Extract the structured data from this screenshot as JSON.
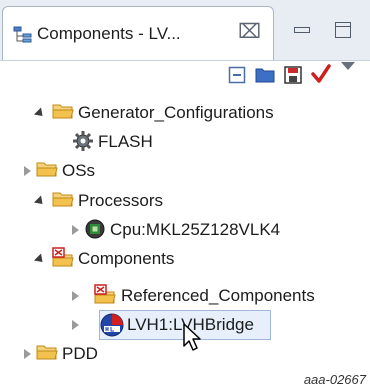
{
  "tab": {
    "title": "Components - LV...",
    "close_glyph": "⌧"
  },
  "toolbar": {
    "icons": [
      "collapse-all-icon",
      "folder-icon",
      "save-icon",
      "checkmark-icon",
      "view-menu-icon"
    ],
    "accent_red": "#d01f1f"
  },
  "tree": {
    "generator": "Generator_Configurations",
    "flash": "FLASH",
    "oss": "OSs",
    "processors": "Processors",
    "cpu": "Cpu:MKL25Z128VLK4",
    "components": "Components",
    "referenced": "Referenced_Components",
    "lvh": "LVH1:LVHBridge",
    "pdd": "PDD"
  },
  "footer": {
    "code": "aaa-02667"
  },
  "colors": {
    "folder": "#f2c14e",
    "folder_border": "#c08a1a",
    "selection_bg": "#e6effa"
  }
}
